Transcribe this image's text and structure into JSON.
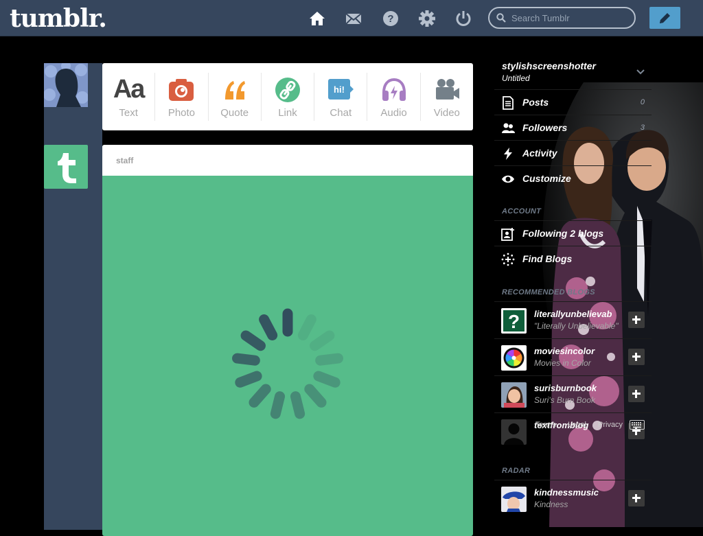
{
  "header": {
    "logo": "tumblr.",
    "search_placeholder": "Search Tumblr",
    "nav": [
      "home-icon",
      "mail-icon",
      "help-icon",
      "settings-icon",
      "power-icon"
    ],
    "compose": "pencil-icon"
  },
  "post_box": {
    "items": [
      {
        "label": "Text",
        "icon": "text-icon",
        "glyph": "Aa"
      },
      {
        "label": "Photo",
        "icon": "camera-icon",
        "color": "#d95e40"
      },
      {
        "label": "Quote",
        "icon": "quote-icon",
        "color": "#f2992e"
      },
      {
        "label": "Link",
        "icon": "link-icon",
        "color": "#56bc8a"
      },
      {
        "label": "Chat",
        "icon": "chat-icon",
        "glyph": "hi!",
        "color": "#529ecc"
      },
      {
        "label": "Audio",
        "icon": "headphones-icon",
        "color": "#a77dc2"
      },
      {
        "label": "Video",
        "icon": "video-camera-icon",
        "color": "#748089"
      }
    ]
  },
  "post": {
    "blog": "staff",
    "background": "#56bc8a"
  },
  "sidebar": {
    "blog_name": "stylishscreenshotter",
    "blog_title": "Untitled",
    "menu": [
      {
        "label": "Posts",
        "count": "0",
        "icon": "posts-icon"
      },
      {
        "label": "Followers",
        "count": "3",
        "icon": "followers-icon"
      },
      {
        "label": "Activity",
        "icon": "activity-icon"
      },
      {
        "label": "Customize",
        "icon": "eye-icon"
      }
    ],
    "account_heading": "ACCOUNT",
    "account": [
      {
        "label": "Following 2 blogs",
        "icon": "following-icon"
      },
      {
        "label": "Find Blogs",
        "icon": "find-blogs-icon"
      }
    ],
    "recommended_heading": "RECOMMENDED BLOGS",
    "recommended": [
      {
        "name": "literallyunbelievab",
        "desc": "\"Literally Unbelievable\"",
        "avatar": "question-avatar"
      },
      {
        "name": "moviesincolor",
        "desc": "Movies in Color",
        "avatar": "color-wheel-avatar"
      },
      {
        "name": "surisburnbook",
        "desc": "Suri's Burn Book",
        "avatar": "girl-avatar"
      },
      {
        "name": "textfromblog",
        "desc": "",
        "avatar": "silhouette-avatar"
      }
    ],
    "radar_heading": "RADAR",
    "radar": [
      {
        "name": "kindnessmusic",
        "desc": "Kindness",
        "avatar": "blue-hat-avatar"
      }
    ],
    "footer": [
      "Terms",
      "Legal",
      "Privacy"
    ]
  }
}
